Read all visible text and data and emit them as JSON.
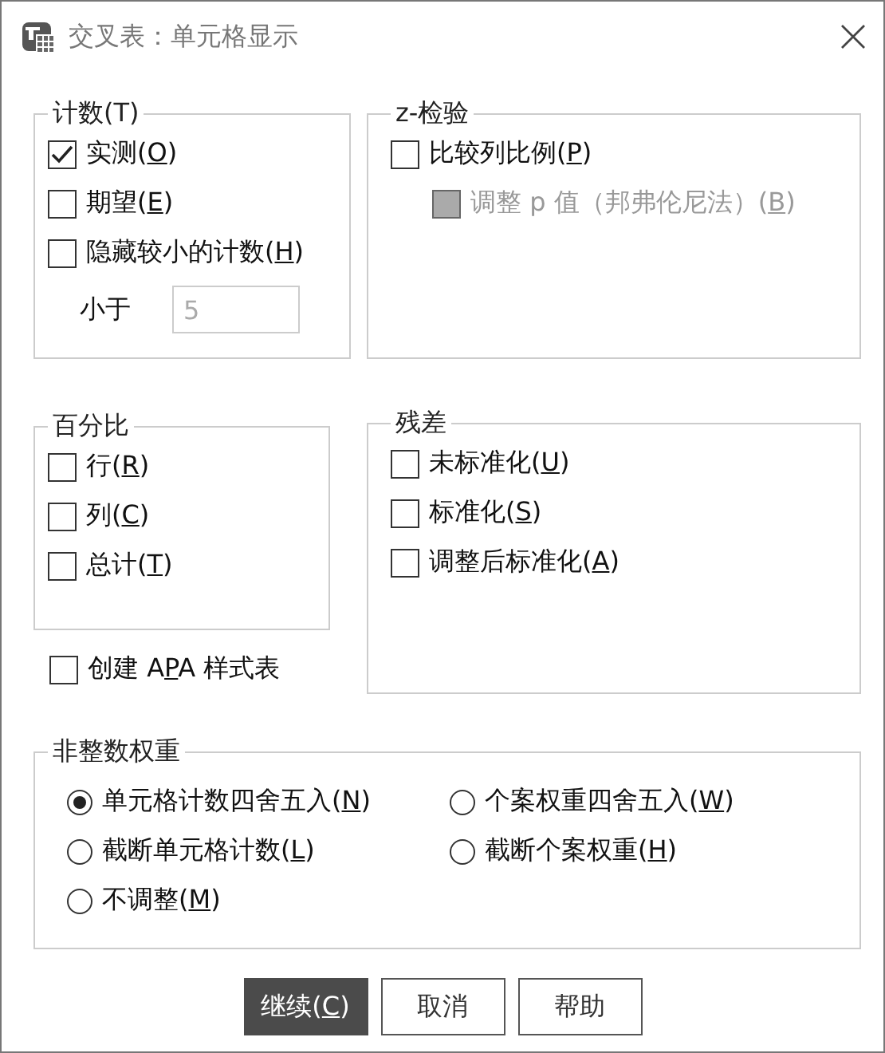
{
  "window": {
    "title": "交叉表：单元格显示"
  },
  "counts": {
    "title": "计数(T)",
    "items": [
      {
        "pre": "实测(",
        "key": "O",
        "post": ")",
        "checked": true,
        "disabled": false
      },
      {
        "pre": "期望(",
        "key": "E",
        "post": ")",
        "checked": false,
        "disabled": false
      },
      {
        "pre": "隐藏较小的计数(",
        "key": "H",
        "post": ")",
        "checked": false,
        "disabled": false
      }
    ],
    "less_than": {
      "label": "小于",
      "value": "5",
      "disabled": true
    }
  },
  "z_test": {
    "title": "z-检验",
    "items": [
      {
        "pre": "比较列比例(",
        "key": "P",
        "post": ")",
        "checked": false,
        "disabled": false,
        "children": [
          {
            "pre": "调整 p 值（邦弗伦尼法）(",
            "key": "B",
            "post": ")",
            "checked": false,
            "disabled": true
          }
        ]
      }
    ]
  },
  "percentages": {
    "title": "百分比",
    "items": [
      {
        "pre": "行(",
        "key": "R",
        "post": ")",
        "checked": false,
        "disabled": false
      },
      {
        "pre": "列(",
        "key": "C",
        "post": ")",
        "checked": false,
        "disabled": false
      },
      {
        "pre": "总计(",
        "key": "T",
        "post": ")",
        "checked": false,
        "disabled": false
      }
    ]
  },
  "apa": {
    "pre": "创建 A",
    "key": "P",
    "post": "A 样式表",
    "checked": false,
    "disabled": false
  },
  "residuals": {
    "title": "残差",
    "items": [
      {
        "pre": "未标准化(",
        "key": "U",
        "post": ")",
        "checked": false,
        "disabled": false
      },
      {
        "pre": "标准化(",
        "key": "S",
        "post": ")",
        "checked": false,
        "disabled": false
      },
      {
        "pre": "调整后标准化(",
        "key": "A",
        "post": ")",
        "checked": false,
        "disabled": false
      }
    ]
  },
  "noninteger_weights": {
    "title": "非整数权重",
    "options": [
      {
        "pre": "单元格计数四舍五入(",
        "key": "N",
        "post": ")",
        "selected": true
      },
      {
        "pre": "个案权重四舍五入(",
        "key": "W",
        "post": ")",
        "selected": false
      },
      {
        "pre": "截断单元格计数(",
        "key": "L",
        "post": ")",
        "selected": false
      },
      {
        "pre": "截断个案权重(",
        "key": "H",
        "post": ")",
        "selected": false
      },
      {
        "pre": "不调整(",
        "key": "M",
        "post": ")",
        "selected": false
      }
    ]
  },
  "buttons": [
    {
      "pre": "继续(",
      "key": "C",
      "post": ")",
      "default": true
    },
    {
      "pre": "取消",
      "default": false
    },
    {
      "pre": "帮助",
      "default": false
    }
  ]
}
